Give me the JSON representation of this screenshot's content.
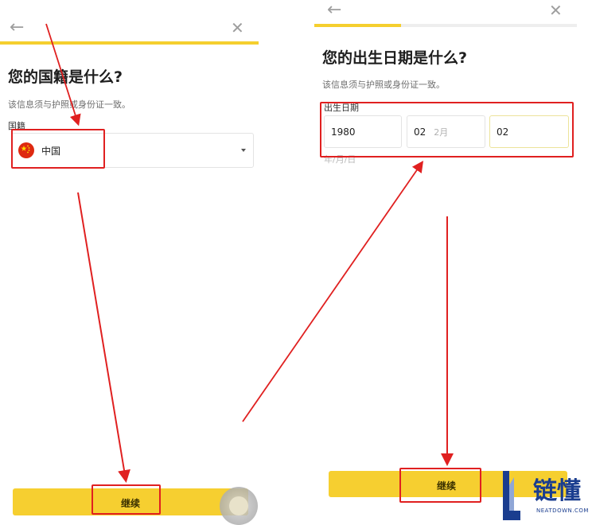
{
  "left_screen": {
    "back_icon": "arrow-left-icon",
    "close_icon": "close-icon",
    "title": "您的国籍是什么?",
    "subtitle": "该信息须与护照或身份证一致。",
    "field_label": "国籍",
    "select_value": "中国",
    "flag_icon": "china-flag-icon",
    "continue_label": "继续"
  },
  "right_screen": {
    "back_icon": "arrow-left-icon",
    "close_icon": "close-icon",
    "progress": 0.33,
    "title": "您的出生日期是什么?",
    "subtitle": "该信息须与护照或身份证一致。",
    "field_label": "出生日期",
    "year_value": "1980",
    "month_value": "02",
    "month_hint": "2月",
    "day_value": "02",
    "format_hint": "年/月/日",
    "continue_label": "继续"
  },
  "watermark": {
    "brand_cn": "链懂",
    "brand_en": "NEATDOWN.COM"
  },
  "colors": {
    "accent_yellow": "#f6cf30",
    "annotation_red": "#e02020",
    "brand_blue": "#1a3d8f"
  }
}
